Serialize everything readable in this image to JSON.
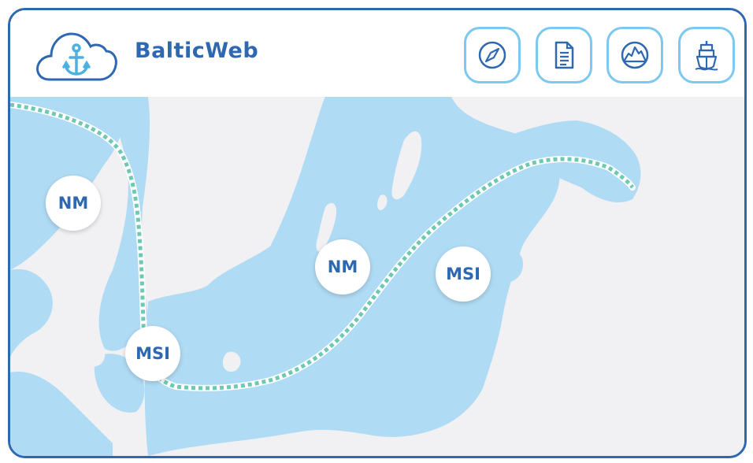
{
  "app": {
    "title": "BalticWeb"
  },
  "nav": [
    {
      "icon": "compass-icon",
      "name": "compass-button"
    },
    {
      "icon": "document-icon",
      "name": "document-button"
    },
    {
      "icon": "iceberg-icon",
      "name": "iceberg-button"
    },
    {
      "icon": "ship-icon",
      "name": "ship-button"
    }
  ],
  "markers": [
    "NM",
    "MSI",
    "NM",
    "MSI"
  ],
  "colors": {
    "brand": "#2e68b1",
    "button_border": "#7cc8ef",
    "water": "#b0dbf4",
    "land": "#f1f1f3",
    "route": "#6fc9b2"
  }
}
